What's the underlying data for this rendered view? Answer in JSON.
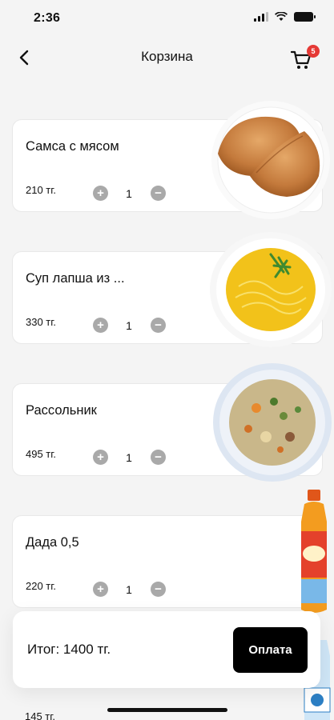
{
  "status": {
    "time": "2:36"
  },
  "header": {
    "title": "Корзина",
    "cart_badge": "5",
    "back_icon": "chevron-left-icon",
    "cart_icon": "cart-icon"
  },
  "items": [
    {
      "name": "Самса с мясом",
      "price": "210 тг.",
      "qty": "1",
      "image": "samsa-image"
    },
    {
      "name": "Суп лапша из ...",
      "price": "330 тг.",
      "qty": "1",
      "image": "noodle-soup-image"
    },
    {
      "name": "Рассольник",
      "price": "495 тг.",
      "qty": "1",
      "image": "rassolnik-image"
    },
    {
      "name": "Дада 0,5",
      "price": "220 тг.",
      "qty": "1",
      "image": "dada-bottle-image"
    },
    {
      "name": "",
      "price": "145 тг.",
      "qty": "",
      "image": "water-bottle-image"
    }
  ],
  "checkout": {
    "total": "Итог: 1400 тг.",
    "pay_label": "Оплата"
  },
  "colors": {
    "badge": "#e53935",
    "pay_button": "#000000",
    "qty_button": "#a9a9a9"
  }
}
